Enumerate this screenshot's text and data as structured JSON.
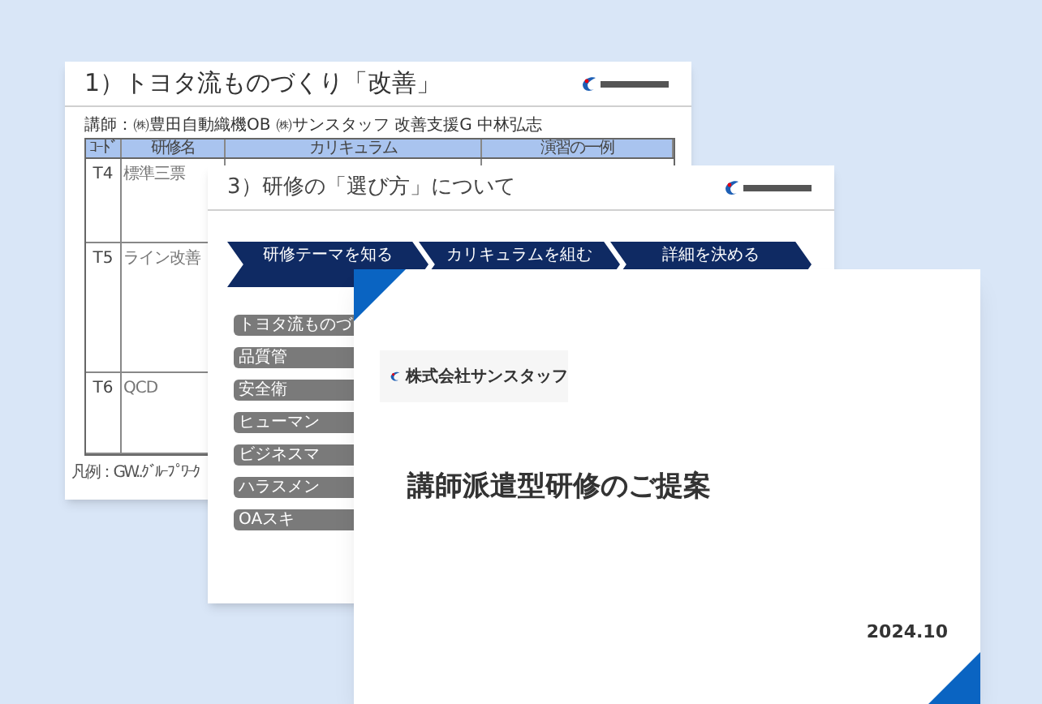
{
  "slides": [
    {
      "kind": "table",
      "title": "1）トヨタ流ものづくり「改善」",
      "instructor": "講師：㈱豊田自動織機OB ㈱サンスタッフ 改善支援G 中林弘志",
      "table": {
        "columns": [
          "ｺｰﾄﾞ",
          "研修名",
          "カリキュラム",
          "演習の一例"
        ],
        "rows": [
          {
            "code": "T4",
            "name": "標準三票"
          },
          {
            "code": "T5",
            "name": "ライン改善"
          },
          {
            "code": "T6",
            "name": "QCD"
          }
        ]
      },
      "legend": "凡例：GW..ｸﾞﾙｰﾌﾟﾜｰｸ"
    },
    {
      "kind": "steps",
      "title": "3）研修の「選び方」について",
      "steps": [
        "研修テーマを知る",
        "カリキュラムを組む",
        "詳細を決める"
      ],
      "themes": [
        "トヨタ流ものづ",
        "品質管",
        "安全衛",
        "ヒューマン",
        "ビジネスマ",
        "ハラスメン",
        "OAスキ"
      ]
    },
    {
      "kind": "cover",
      "company": "株式会社サンスタッフ",
      "title": "講師派遣型研修のご提案",
      "date": "2024.10"
    }
  ]
}
